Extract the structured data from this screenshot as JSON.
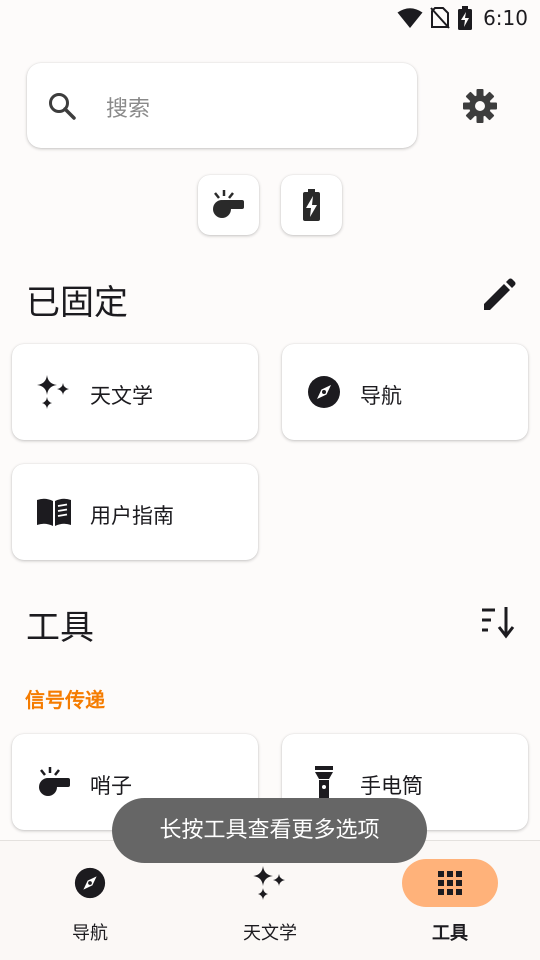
{
  "status_bar": {
    "time": "6:10"
  },
  "search": {
    "placeholder": "搜索"
  },
  "pinned": {
    "title": "已固定",
    "items": [
      {
        "label": "天文学",
        "icon": "sparkles-icon"
      },
      {
        "label": "导航",
        "icon": "compass-icon"
      },
      {
        "label": "用户指南",
        "icon": "book-icon"
      }
    ]
  },
  "tools": {
    "title": "工具",
    "category": "信号传递",
    "items": [
      {
        "label": "哨子",
        "icon": "whistle-icon"
      },
      {
        "label": "手电筒",
        "icon": "flashlight-icon"
      }
    ]
  },
  "toast": {
    "text": "长按工具查看更多选项"
  },
  "bottom_nav": {
    "items": [
      {
        "label": "导航",
        "icon": "compass-icon",
        "active": false
      },
      {
        "label": "天文学",
        "icon": "sparkles-icon",
        "active": false
      },
      {
        "label": "工具",
        "icon": "grid-icon",
        "active": true
      }
    ]
  },
  "colors": {
    "accent": "#f57c00",
    "active_nav_bg": "#ffb27a",
    "toast_bg": "#666666"
  }
}
